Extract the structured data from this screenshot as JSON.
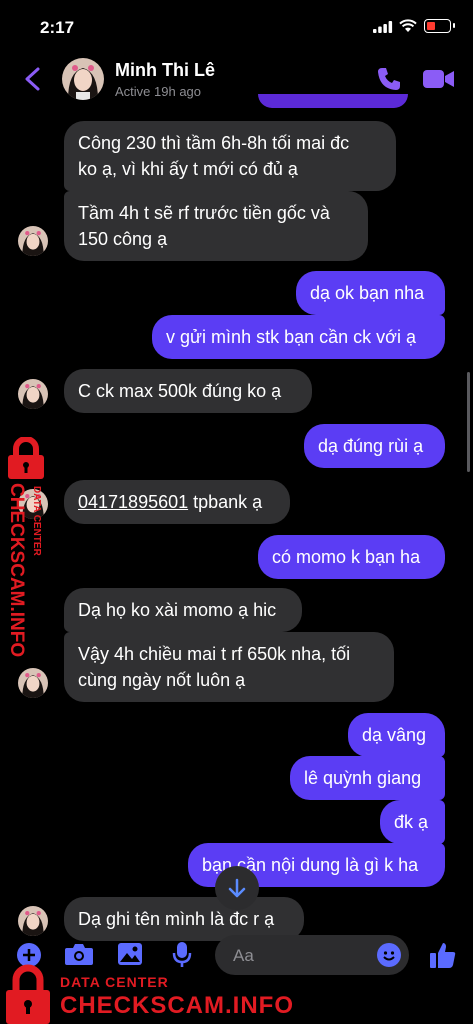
{
  "status_bar": {
    "time": "2:17"
  },
  "header": {
    "name": "Minh Thi Lê",
    "status": "Active 19h ago"
  },
  "messages": [
    {
      "side": "recv",
      "text": "Công 230 thì tầm 6h-8h tối mai đc\nko ạ, vì khi ấy t mới có đủ ạ"
    },
    {
      "side": "recv",
      "text": "Tầm 4h t sẽ rf trước tiền gốc và\n150 công ạ"
    },
    {
      "side": "sent",
      "text": "dạ ok bạn nha"
    },
    {
      "side": "sent",
      "text": "v gửi mình stk bạn cần ck với ạ"
    },
    {
      "side": "recv",
      "text": "C ck max 500k đúng ko ạ"
    },
    {
      "side": "sent",
      "text": "dạ đúng rùi ạ"
    },
    {
      "side": "recv",
      "account": "04171895601",
      "text": " tpbank ạ"
    },
    {
      "side": "sent",
      "text": "có momo k bạn ha"
    },
    {
      "side": "recv",
      "text": "Dạ họ ko xài momo ạ hic"
    },
    {
      "side": "recv",
      "text": "Vậy 4h chiều mai t rf 650k nha, tối\ncùng ngày nốt luôn ạ"
    },
    {
      "side": "sent",
      "text": "dạ vâng"
    },
    {
      "side": "sent",
      "text": "lê quỳnh giang"
    },
    {
      "side": "sent",
      "text": "đk ạ"
    },
    {
      "side": "sent",
      "text": "bạn cần nội dung là gì k ha"
    },
    {
      "side": "recv",
      "text": "Dạ ghi tên mình là đc r ạ"
    }
  ],
  "composer": {
    "placeholder": "Aa"
  },
  "watermark": {
    "line1": "DATA CENTER",
    "line2": "CHECKSCAM.INFO"
  },
  "colors": {
    "sent_bubble": "#5b3df4",
    "recv_bubble": "#303032",
    "accent": "#8b5cf6",
    "watermark": "#e11b22"
  }
}
